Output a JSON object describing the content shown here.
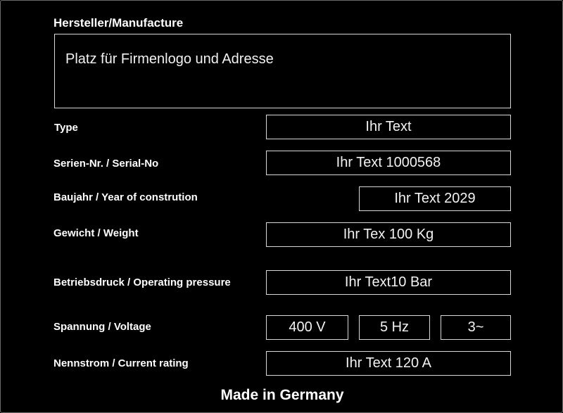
{
  "plate": {
    "manufacturer_label": "Hersteller/Manufacture",
    "logo_placeholder": "Platz für Firmenlogo und Adresse",
    "fields": {
      "type": {
        "label": "Type",
        "value": "Ihr Text"
      },
      "serial": {
        "label": "Serien-Nr. / Serial-No",
        "value": "Ihr Text 1000568"
      },
      "year": {
        "label": "Baujahr / Year of constrution",
        "value": "Ihr Text 2029"
      },
      "weight": {
        "label": "Gewicht / Weight",
        "value": "Ihr Tex 100 Kg"
      },
      "pressure": {
        "label": "Betriebsdruck / Operating pressure",
        "value": "Ihr Text10 Bar"
      },
      "voltage": {
        "label": "Spannung / Voltage",
        "voltage": "400 V",
        "frequency": "5 Hz",
        "phase": "3~"
      },
      "current": {
        "label": "Nennstrom / Current rating",
        "value": "Ihr Text 120 A"
      }
    },
    "footer": "Made in Germany"
  }
}
